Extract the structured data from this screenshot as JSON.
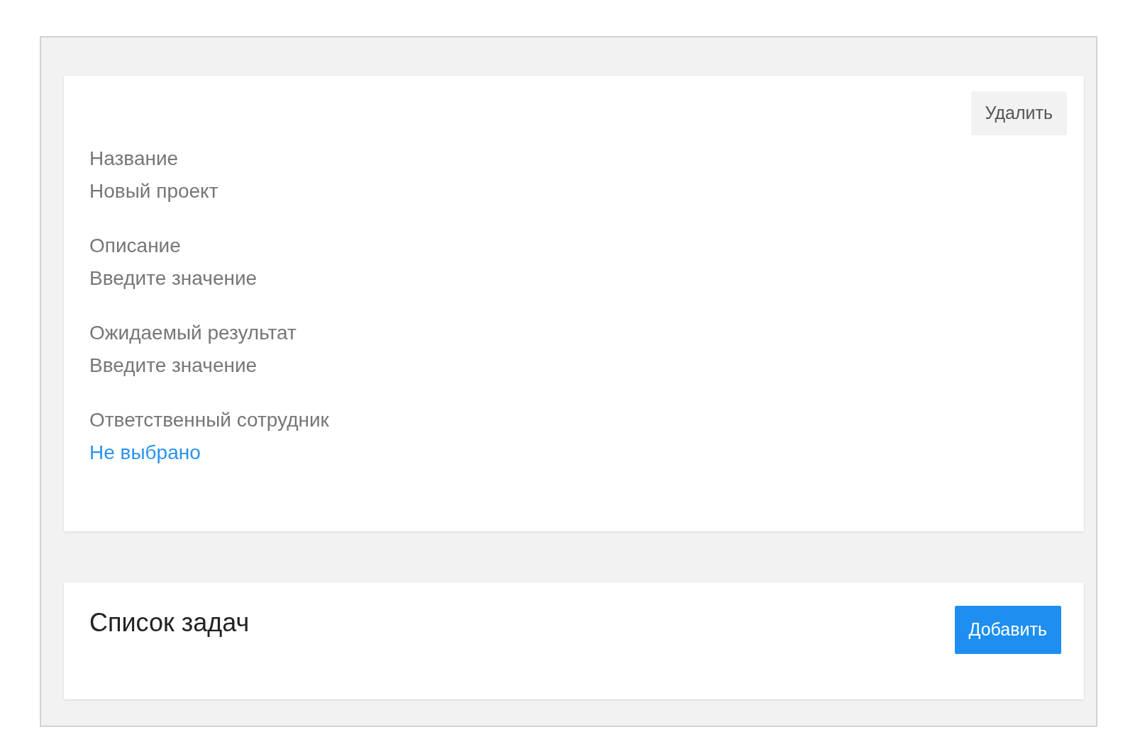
{
  "project_card": {
    "delete_button": "Удалить",
    "fields": [
      {
        "label": "Название",
        "value": "Новый проект",
        "kind": "text"
      },
      {
        "label": "Описание",
        "value": "Введите значение",
        "kind": "text"
      },
      {
        "label": "Ожидаемый результат",
        "value": "Введите значение",
        "kind": "text"
      },
      {
        "label": "Ответственный сотрудник",
        "value": "Не выбрано",
        "kind": "link"
      }
    ]
  },
  "tasks_card": {
    "title": "Список задач",
    "add_button": "Добавить"
  }
}
